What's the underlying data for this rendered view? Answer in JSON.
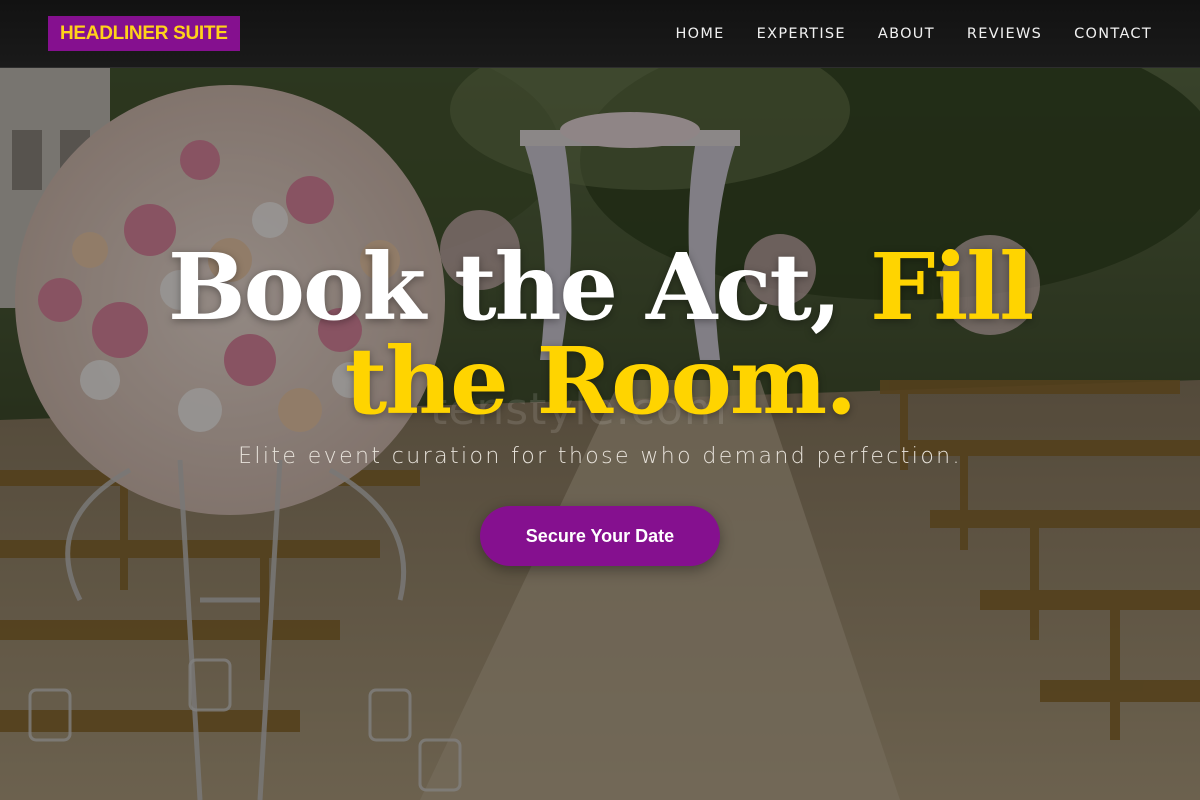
{
  "brand": {
    "name": "HEADLINER SUITE"
  },
  "nav": {
    "items": [
      {
        "label": "HOME"
      },
      {
        "label": "EXPERTISE"
      },
      {
        "label": "ABOUT"
      },
      {
        "label": "REVIEWS"
      },
      {
        "label": "CONTACT"
      }
    ]
  },
  "hero": {
    "headline_white_1": "Book the Act,",
    "headline_yellow_1": "Fill",
    "headline_yellow_2": "the Room.",
    "tagline": "Elite event curation for those who demand perfection.",
    "cta_label": "Secure Your Date",
    "watermark": "tenstyle.com"
  },
  "colors": {
    "accent_purple": "#85108f",
    "accent_yellow": "#ffd400",
    "nav_bg": "#121212"
  }
}
